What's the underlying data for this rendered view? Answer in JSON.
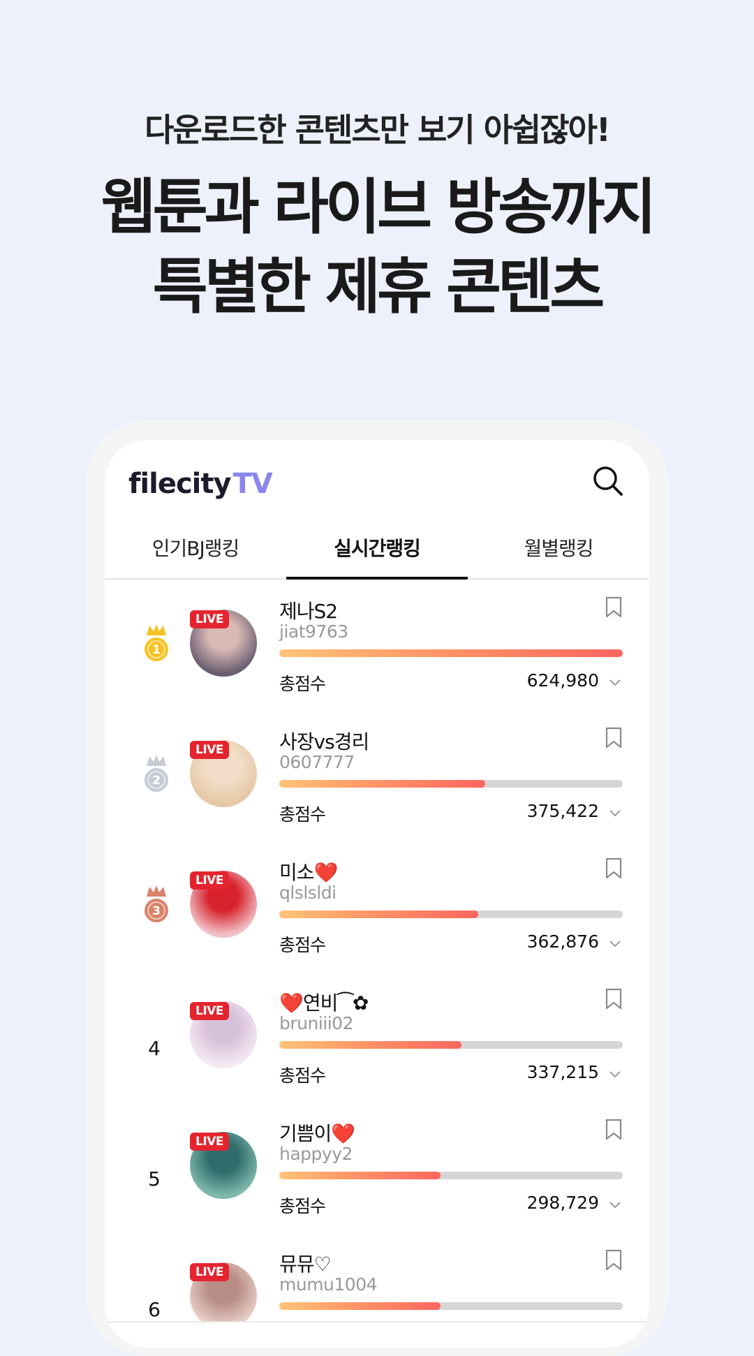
{
  "promo": {
    "subtitle": "다운로드한 콘텐츠만 보기 아쉽잖아!",
    "headline_line1": "웹툰과 라이브 방송까지",
    "headline_line2": "특별한 제휴 콘텐츠"
  },
  "app": {
    "logo_main": "filecity",
    "logo_tv": "TV",
    "search_icon": "search-icon",
    "tabs": [
      {
        "label": "인기BJ랭킹",
        "active": false
      },
      {
        "label": "실시간랭킹",
        "active": true
      },
      {
        "label": "월별랭킹",
        "active": false
      }
    ],
    "score_label": "총점수",
    "live_badge": "LIVE",
    "colors": {
      "gold": "#f6c324",
      "silver": "#c6ccd4",
      "bronze": "#d9826a",
      "live": "#e4242e",
      "accent": "#8a86ee"
    }
  },
  "ranking": [
    {
      "rank": "1",
      "name": "제나S2",
      "handle": "jiat9763",
      "score": "624,980",
      "progress": 1.0,
      "medal": "gold",
      "avatar": [
        "#6a5e72",
        "#d9b9b4"
      ]
    },
    {
      "rank": "2",
      "name": "사장vs경리",
      "handle": "0607777",
      "score": "375,422",
      "progress": 0.6,
      "medal": "silver",
      "avatar": [
        "#e6c8a6",
        "#f3dfc9"
      ]
    },
    {
      "rank": "3",
      "name": "미소",
      "name_suffix": "❤️",
      "handle": "qlslsldi",
      "score": "362,876",
      "progress": 0.58,
      "medal": "bronze",
      "avatar": [
        "#f0c2c6",
        "#d8232f"
      ]
    },
    {
      "rank": "4",
      "name_prefix": "❤️",
      "name": "연비⁀✿",
      "handle": "bruniii02",
      "score": "337,215",
      "progress": 0.53,
      "medal": "",
      "avatar": [
        "#f4e8f3",
        "#d7c0d9"
      ]
    },
    {
      "rank": "5",
      "name": "기쁨이",
      "name_suffix": "❤️",
      "handle": "happyy2",
      "score": "298,729",
      "progress": 0.47,
      "medal": "",
      "avatar": [
        "#7fb8ac",
        "#2f6d6c"
      ]
    },
    {
      "rank": "6",
      "name": "뮤뮤♡",
      "handle": "mumu1004",
      "score": "",
      "progress": 0.47,
      "medal": "",
      "avatar": [
        "#e8cfc8",
        "#b88d86"
      ]
    }
  ]
}
